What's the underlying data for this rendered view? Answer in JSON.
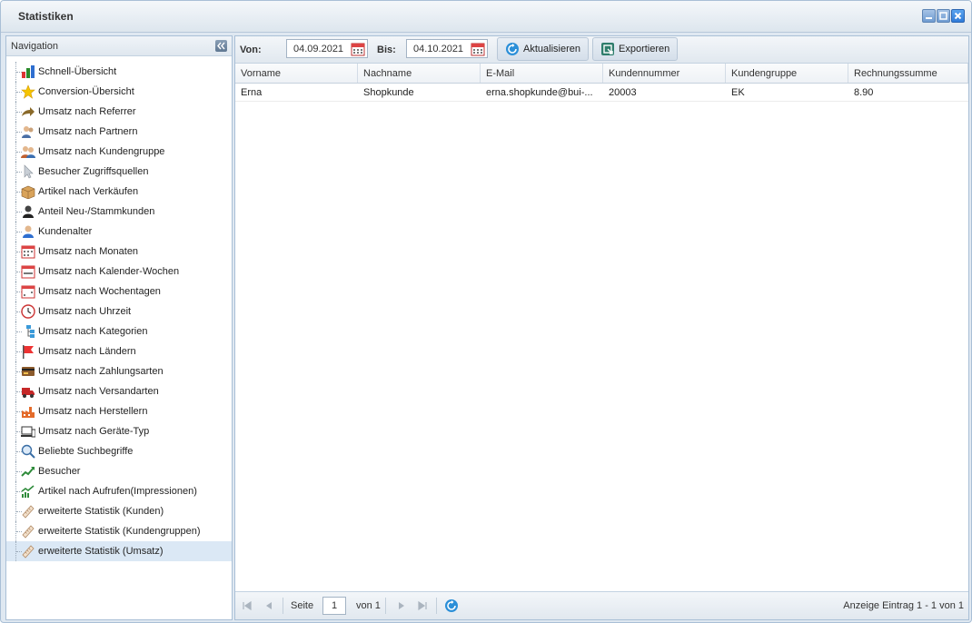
{
  "window": {
    "title": "Statistiken"
  },
  "sidebar": {
    "title": "Navigation",
    "items": [
      {
        "label": "Schnell-Übersicht",
        "icon": "bar-chart-icon"
      },
      {
        "label": "Conversion-Übersicht",
        "icon": "star-icon"
      },
      {
        "label": "Umsatz nach Referrer",
        "icon": "forward-arrow-icon"
      },
      {
        "label": "Umsatz nach Partnern",
        "icon": "partner-icon"
      },
      {
        "label": "Umsatz nach Kundengruppe",
        "icon": "user-group-icon"
      },
      {
        "label": "Besucher Zugriffsquellen",
        "icon": "cursor-icon"
      },
      {
        "label": "Artikel nach Verkäufen",
        "icon": "box-icon"
      },
      {
        "label": "Anteil Neu-/Stammkunden",
        "icon": "customer-icon"
      },
      {
        "label": "Kundenalter",
        "icon": "user-icon"
      },
      {
        "label": "Umsatz nach Monaten",
        "icon": "calendar-month-icon"
      },
      {
        "label": "Umsatz nach Kalender-Wochen",
        "icon": "calendar-week-icon"
      },
      {
        "label": "Umsatz nach Wochentagen",
        "icon": "calendar-day-icon"
      },
      {
        "label": "Umsatz nach Uhrzeit",
        "icon": "clock-icon"
      },
      {
        "label": "Umsatz nach Kategorien",
        "icon": "category-tree-icon"
      },
      {
        "label": "Umsatz nach Ländern",
        "icon": "flag-icon"
      },
      {
        "label": "Umsatz nach Zahlungsarten",
        "icon": "credit-card-icon"
      },
      {
        "label": "Umsatz nach Versandarten",
        "icon": "truck-icon"
      },
      {
        "label": "Umsatz nach Herstellern",
        "icon": "factory-icon"
      },
      {
        "label": "Umsatz nach Geräte-Typ",
        "icon": "device-icon"
      },
      {
        "label": "Beliebte Suchbegriffe",
        "icon": "magnifier-icon"
      },
      {
        "label": "Besucher",
        "icon": "trend-line-icon"
      },
      {
        "label": "Artikel nach Aufrufen(Impressionen)",
        "icon": "trend-chart-icon"
      },
      {
        "label": "erweiterte Statistik (Kunden)",
        "icon": "ruler-icon"
      },
      {
        "label": "erweiterte Statistik (Kundengruppen)",
        "icon": "ruler-icon"
      },
      {
        "label": "erweiterte Statistik (Umsatz)",
        "icon": "ruler-icon",
        "selected": true
      }
    ]
  },
  "toolbar": {
    "from_label": "Von:",
    "from_value": "04.09.2021",
    "to_label": "Bis:",
    "to_value": "04.10.2021",
    "refresh_label": "Aktualisieren",
    "export_label": "Exportieren"
  },
  "grid": {
    "columns": [
      "Vorname",
      "Nachname",
      "E-Mail",
      "Kundennummer",
      "Kundengruppe",
      "Rechnungssumme"
    ],
    "rows": [
      [
        "Erna",
        "Shopkunde",
        "erna.shopkunde@bui-...",
        "20003",
        "EK",
        "8.90"
      ]
    ]
  },
  "pager": {
    "page_label": "Seite",
    "page_value": "1",
    "of_label": "von 1",
    "display_text": "Anzeige Eintrag 1 - 1 von 1"
  }
}
